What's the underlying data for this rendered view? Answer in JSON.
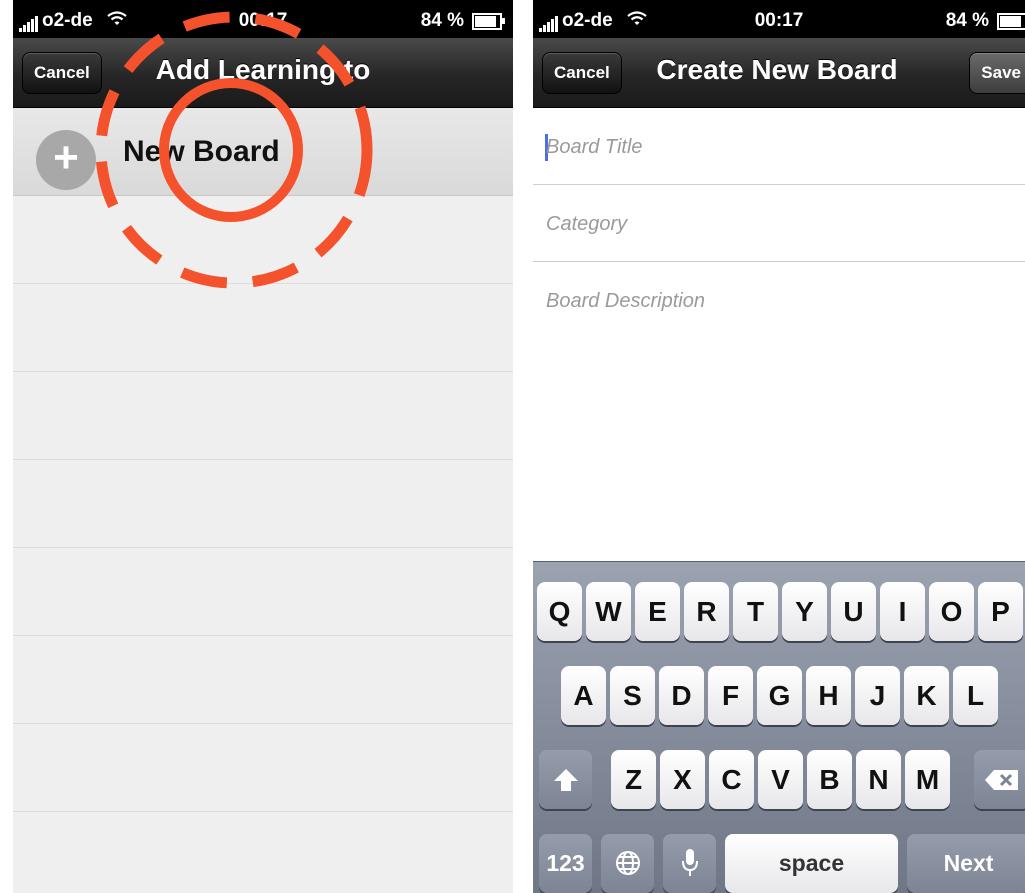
{
  "status_bar": {
    "carrier": "o2-de",
    "time": "00:17",
    "battery": "84 %"
  },
  "left_screen": {
    "cancel_label": "Cancel",
    "title": "Add Learning to",
    "new_board_label": "New Board",
    "plus_symbol": "+",
    "annotation_color": "#f4522c"
  },
  "right_screen": {
    "cancel_label": "Cancel",
    "title": "Create New Board",
    "save_label": "Save",
    "board_title_placeholder": "Board Title",
    "category_placeholder": "Category",
    "board_description_placeholder": "Board Description"
  },
  "keyboard": {
    "row1": [
      "Q",
      "W",
      "E",
      "R",
      "T",
      "Y",
      "U",
      "I",
      "O",
      "P"
    ],
    "row2": [
      "A",
      "S",
      "D",
      "F",
      "G",
      "H",
      "J",
      "K",
      "L"
    ],
    "row3": [
      "Z",
      "X",
      "C",
      "V",
      "B",
      "N",
      "M"
    ],
    "numbers_label": "123",
    "space_label": "space",
    "next_label": "Next",
    "icons": {
      "shift": "shift-icon",
      "delete": "backspace-icon",
      "globe": "globe-icon",
      "mic": "microphone-icon"
    }
  }
}
